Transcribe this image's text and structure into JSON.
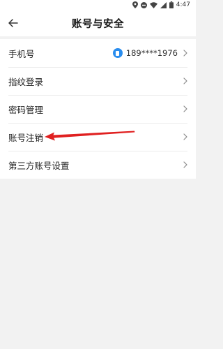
{
  "status_bar": {
    "time": "4:47",
    "icons": [
      "location-icon",
      "dnd-icon",
      "wifi-icon",
      "signal-icon",
      "battery-icon"
    ]
  },
  "header": {
    "title": "账号与安全",
    "back_icon": "arrow-left-icon"
  },
  "settings": {
    "items": [
      {
        "label": "手机号",
        "value": "189****1976",
        "icon": "phone-icon"
      },
      {
        "label": "指纹登录"
      },
      {
        "label": "密码管理"
      },
      {
        "label": "账号注销"
      },
      {
        "label": "第三方账号设置"
      }
    ]
  },
  "colors": {
    "accent": "#2a8dee",
    "annotation": "#e02020",
    "background": "#f2f2f2"
  }
}
